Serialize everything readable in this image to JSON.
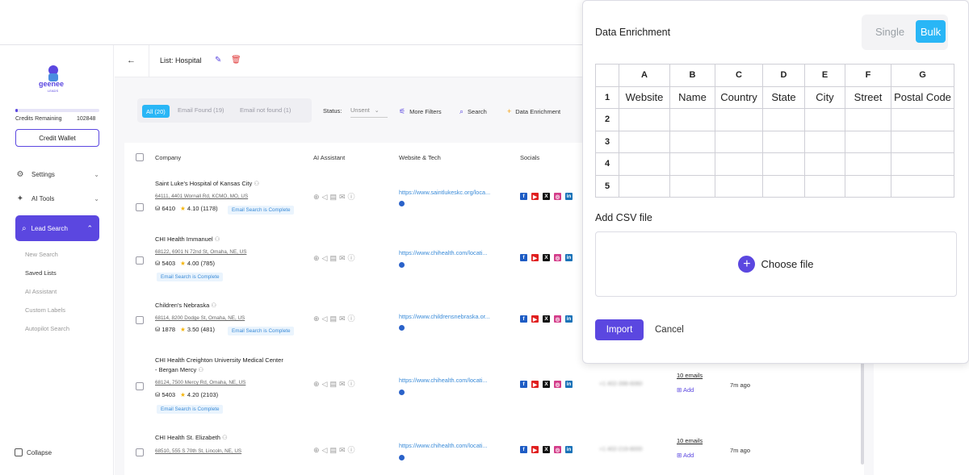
{
  "sidebar": {
    "logo_text": "geenee",
    "logo_sub": "LEADS",
    "credits_label": "Credits Remaining",
    "credits_value": "102848",
    "wallet_label": "Credit Wallet",
    "settings_label": "Settings",
    "ai_tools_label": "AI Tools",
    "lead_search_label": "Lead Search",
    "sub_items": [
      "New Search",
      "Saved Lists",
      "AI Assistant",
      "Custom Labels",
      "Autopilot Search"
    ],
    "collapse_label": "Collapse"
  },
  "header": {
    "back_icon": "←",
    "title": "List: Hospital"
  },
  "filters": {
    "all": "All (20)",
    "found": "Email Found (19)",
    "not_found": "Email not found (1)",
    "status_label": "Status:",
    "status_value": "Unsent",
    "more_filters": "More Filters",
    "search": "Search",
    "enrichment": "Data Enrichment"
  },
  "table": {
    "headers": [
      "Company",
      "AI Assistant",
      "Website & Tech",
      "Socials"
    ],
    "rows": [
      {
        "name": "Saint Luke's Hospital of Kansas City",
        "name2": "",
        "address": "64111, 4401 Wornall Rd, KCMO, MO, US",
        "count": "6410",
        "rating": "4.10 (1178)",
        "badge": "Email Search is Complete",
        "website": "https://www.saintlukeskc.org/loca...",
        "phone": "",
        "emails": "",
        "add": "",
        "time": ""
      },
      {
        "name": "CHI Health Immanuel",
        "name2": "",
        "address": "68122, 6901 N 72nd St, Omaha, NE, US",
        "count": "5403",
        "rating": "4.00 (785)",
        "badge": "Email Search is Complete",
        "website": "https://www.chihealth.com/locati...",
        "phone": "",
        "emails": "",
        "add": "",
        "time": ""
      },
      {
        "name": "Children's Nebraska",
        "name2": "",
        "address": "68114, 8200 Dodge St, Omaha, NE, US",
        "count": "1878",
        "rating": "3.50 (481)",
        "badge": "Email Search is Complete",
        "website": "https://www.childrensnebraska.or...",
        "phone": "",
        "emails": "",
        "add": "",
        "time": ""
      },
      {
        "name": "CHI Health Creighton University Medical Center",
        "name2": "- Bergan Mercy",
        "address": "68124, 7500 Mercy Rd, Omaha, NE, US",
        "count": "5403",
        "rating": "4.20 (2103)",
        "badge": "Email Search is Complete",
        "website": "https://www.chihealth.com/locati...",
        "phone": "+1 402-398-6060",
        "emails": "10 emails",
        "add": "Add",
        "time": "7m ago"
      },
      {
        "name": "CHI Health St. Elizabeth",
        "name2": "",
        "address": "68510, 555 S 70th St, Lincoln, NE, US",
        "count": "",
        "rating": "",
        "badge": "",
        "website": "https://www.chihealth.com/locati...",
        "phone": "+1 402-219-8000",
        "emails": "10 emails",
        "add": "Add",
        "time": "7m ago"
      }
    ]
  },
  "modal": {
    "title": "Data Enrichment",
    "toggle_single": "Single",
    "toggle_bulk": "Bulk",
    "columns": [
      "A",
      "B",
      "C",
      "D",
      "E",
      "F",
      "G"
    ],
    "fields": [
      "Website",
      "Name",
      "Country",
      "State",
      "City",
      "Street",
      "Postal Code"
    ],
    "row_numbers": [
      "1",
      "2",
      "3",
      "4",
      "5"
    ],
    "csv_label": "Add CSV file",
    "choose_file": "Choose file",
    "import_label": "Import",
    "cancel_label": "Cancel"
  },
  "colors": {
    "accent": "#5b47e0",
    "chip": "#29b6f6"
  }
}
